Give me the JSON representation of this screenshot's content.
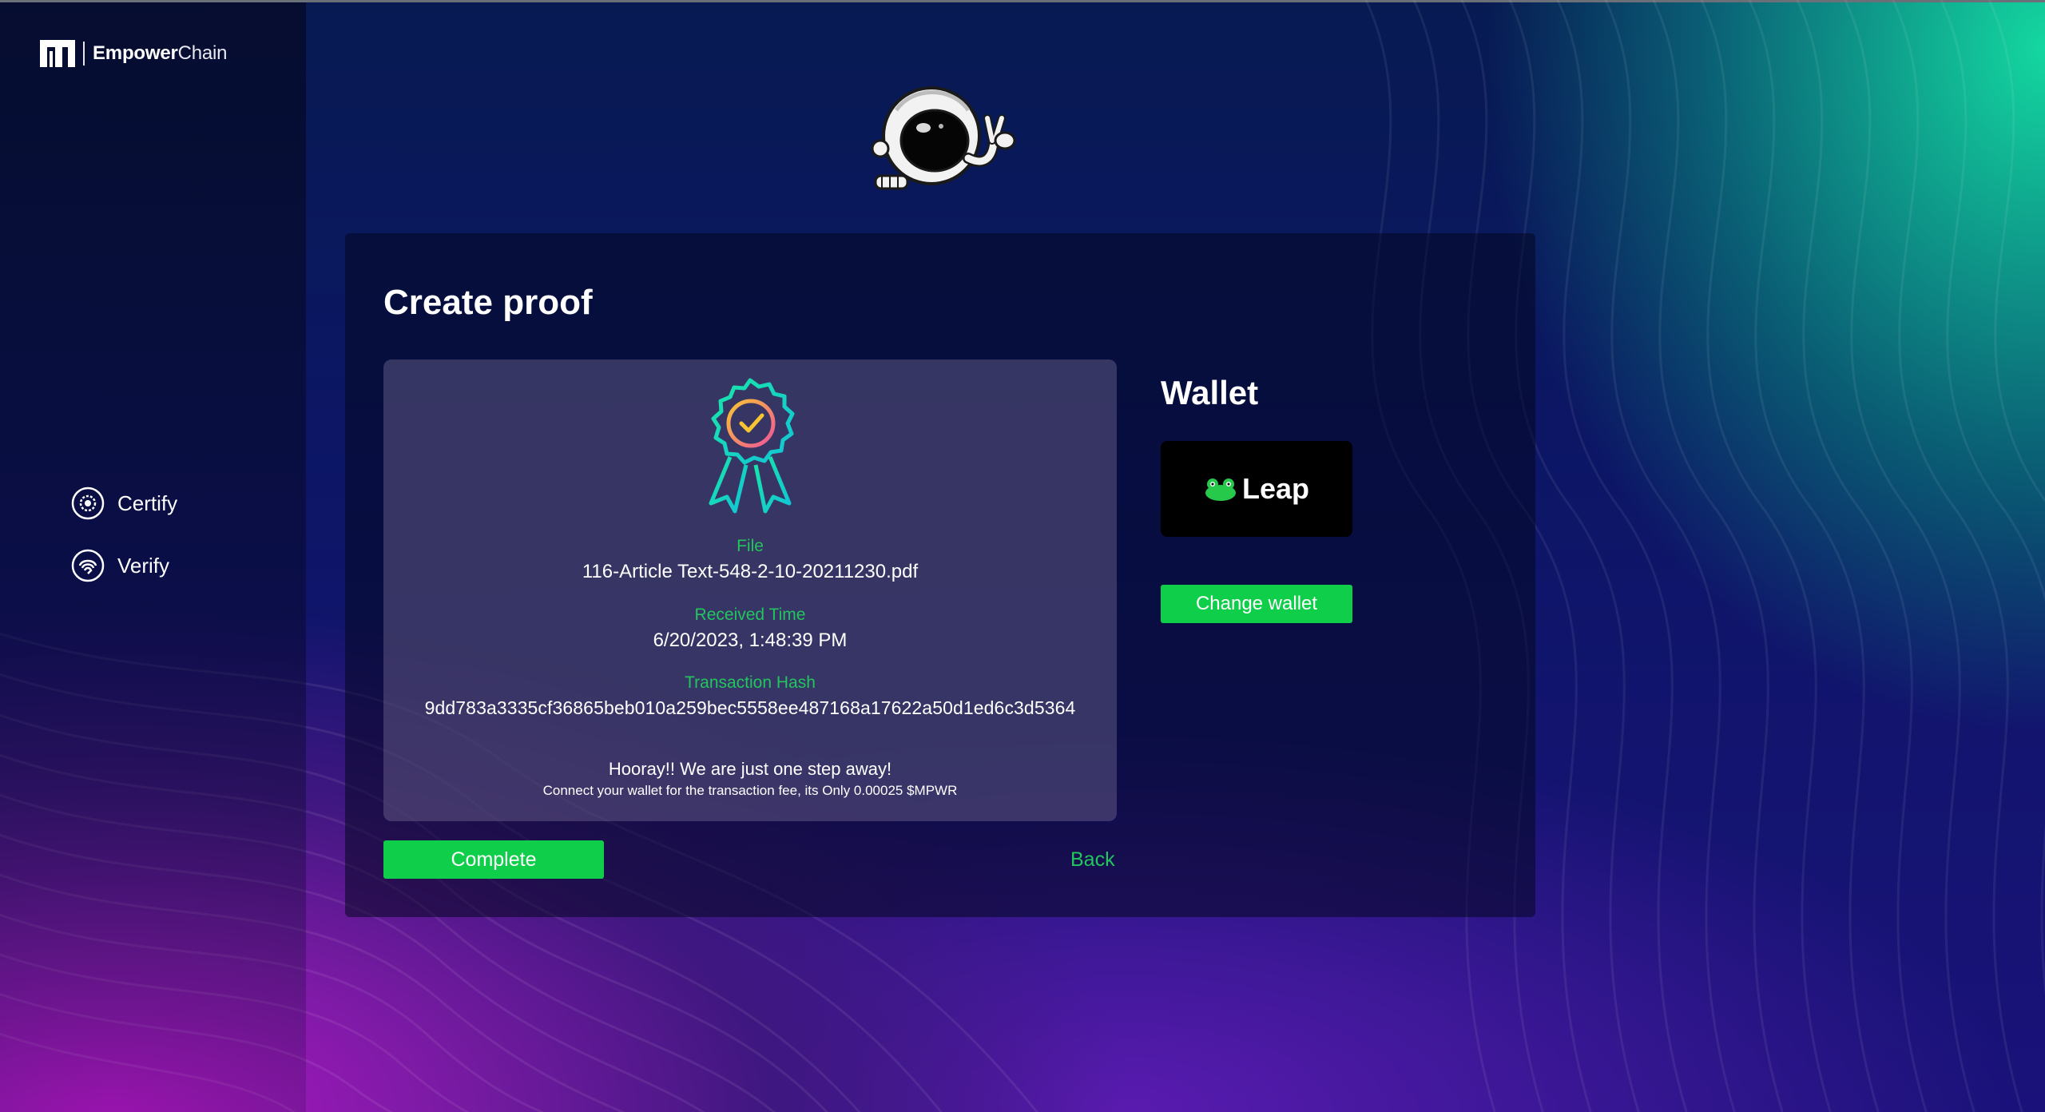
{
  "brand": {
    "name_bold": "Empower",
    "name_light": "Chain"
  },
  "sidebar": {
    "items": [
      {
        "label": "Certify",
        "icon": "certify-icon"
      },
      {
        "label": "Verify",
        "icon": "verify-icon"
      }
    ]
  },
  "main": {
    "title": "Create proof",
    "proof": {
      "file_label": "File",
      "file_value": "116-Article Text-548-2-10-20211230.pdf",
      "time_label": "Received Time",
      "time_value": "6/20/2023, 1:48:39 PM",
      "hash_label": "Transaction Hash",
      "hash_value": "9dd783a3335cf36865beb010a259bec5558ee487168a17622a50d1ed6c3d5364",
      "message": "Hooray!! We are just one step away!",
      "fee_note": "Connect your wallet for the transaction fee, its Only 0.00025 $MPWR"
    },
    "complete_label": "Complete",
    "back_label": "Back"
  },
  "wallet": {
    "title": "Wallet",
    "provider": "Leap",
    "change_label": "Change wallet"
  },
  "colors": {
    "accent_green": "#0fcf4a",
    "label_green": "#22c55e",
    "teal": "#14d7a0",
    "magenta": "#b317c6"
  }
}
